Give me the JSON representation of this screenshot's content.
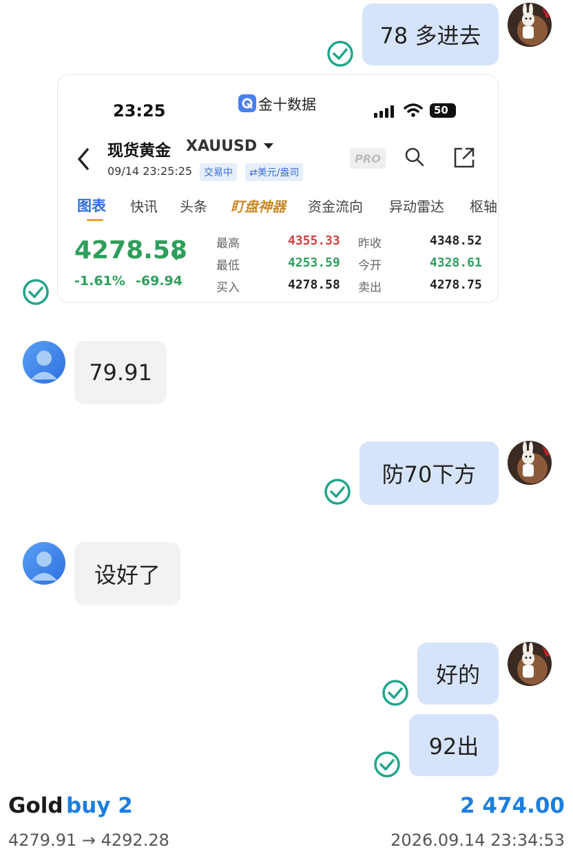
{
  "messages": {
    "m1": "78 多进去",
    "m2": "79.91",
    "m3": "防70下方",
    "m4": "设好了",
    "m5": "好的",
    "m6": "92出"
  },
  "embedded": {
    "status_time": "23:25",
    "app_name": "金十数据",
    "battery": "50",
    "title": "现货黄金",
    "symbol": "XAUUSD",
    "datetime": "09/14 23:25:25",
    "badge_trading": "交易中",
    "badge_unit": "⇄美元/盎司",
    "pro_label": "PRO",
    "tabs": [
      "图表",
      "快讯",
      "头条",
      "盯盘神器",
      "资金流向",
      "异动雷达",
      "枢轴"
    ],
    "price": "4278.58",
    "change_pct": "-1.61%",
    "change_abs": "-69.94",
    "stats": {
      "high_label": "最高",
      "high_value": "4355.33",
      "low_label": "最低",
      "low_value": "4253.59",
      "buy_label": "买入",
      "buy_value": "4278.58",
      "prev_label": "昨收",
      "prev_value": "4348.52",
      "open_label": "今开",
      "open_value": "4328.61",
      "sell_label": "卖出",
      "sell_value": "4278.75"
    }
  },
  "trade": {
    "asset": "Gold",
    "action": "buy 2",
    "profit": "2 474.00",
    "range": "4279.91 → 4292.28",
    "timestamp": "2026.09.14 23:34:53"
  },
  "colors": {
    "check_green": "#1fa58a",
    "bubble_out": "#d6e4fb",
    "bubble_in": "#f2f2f2",
    "price_green": "#2e9e5b",
    "price_red": "#d33f3f",
    "accent_blue": "#1c7fe0"
  }
}
